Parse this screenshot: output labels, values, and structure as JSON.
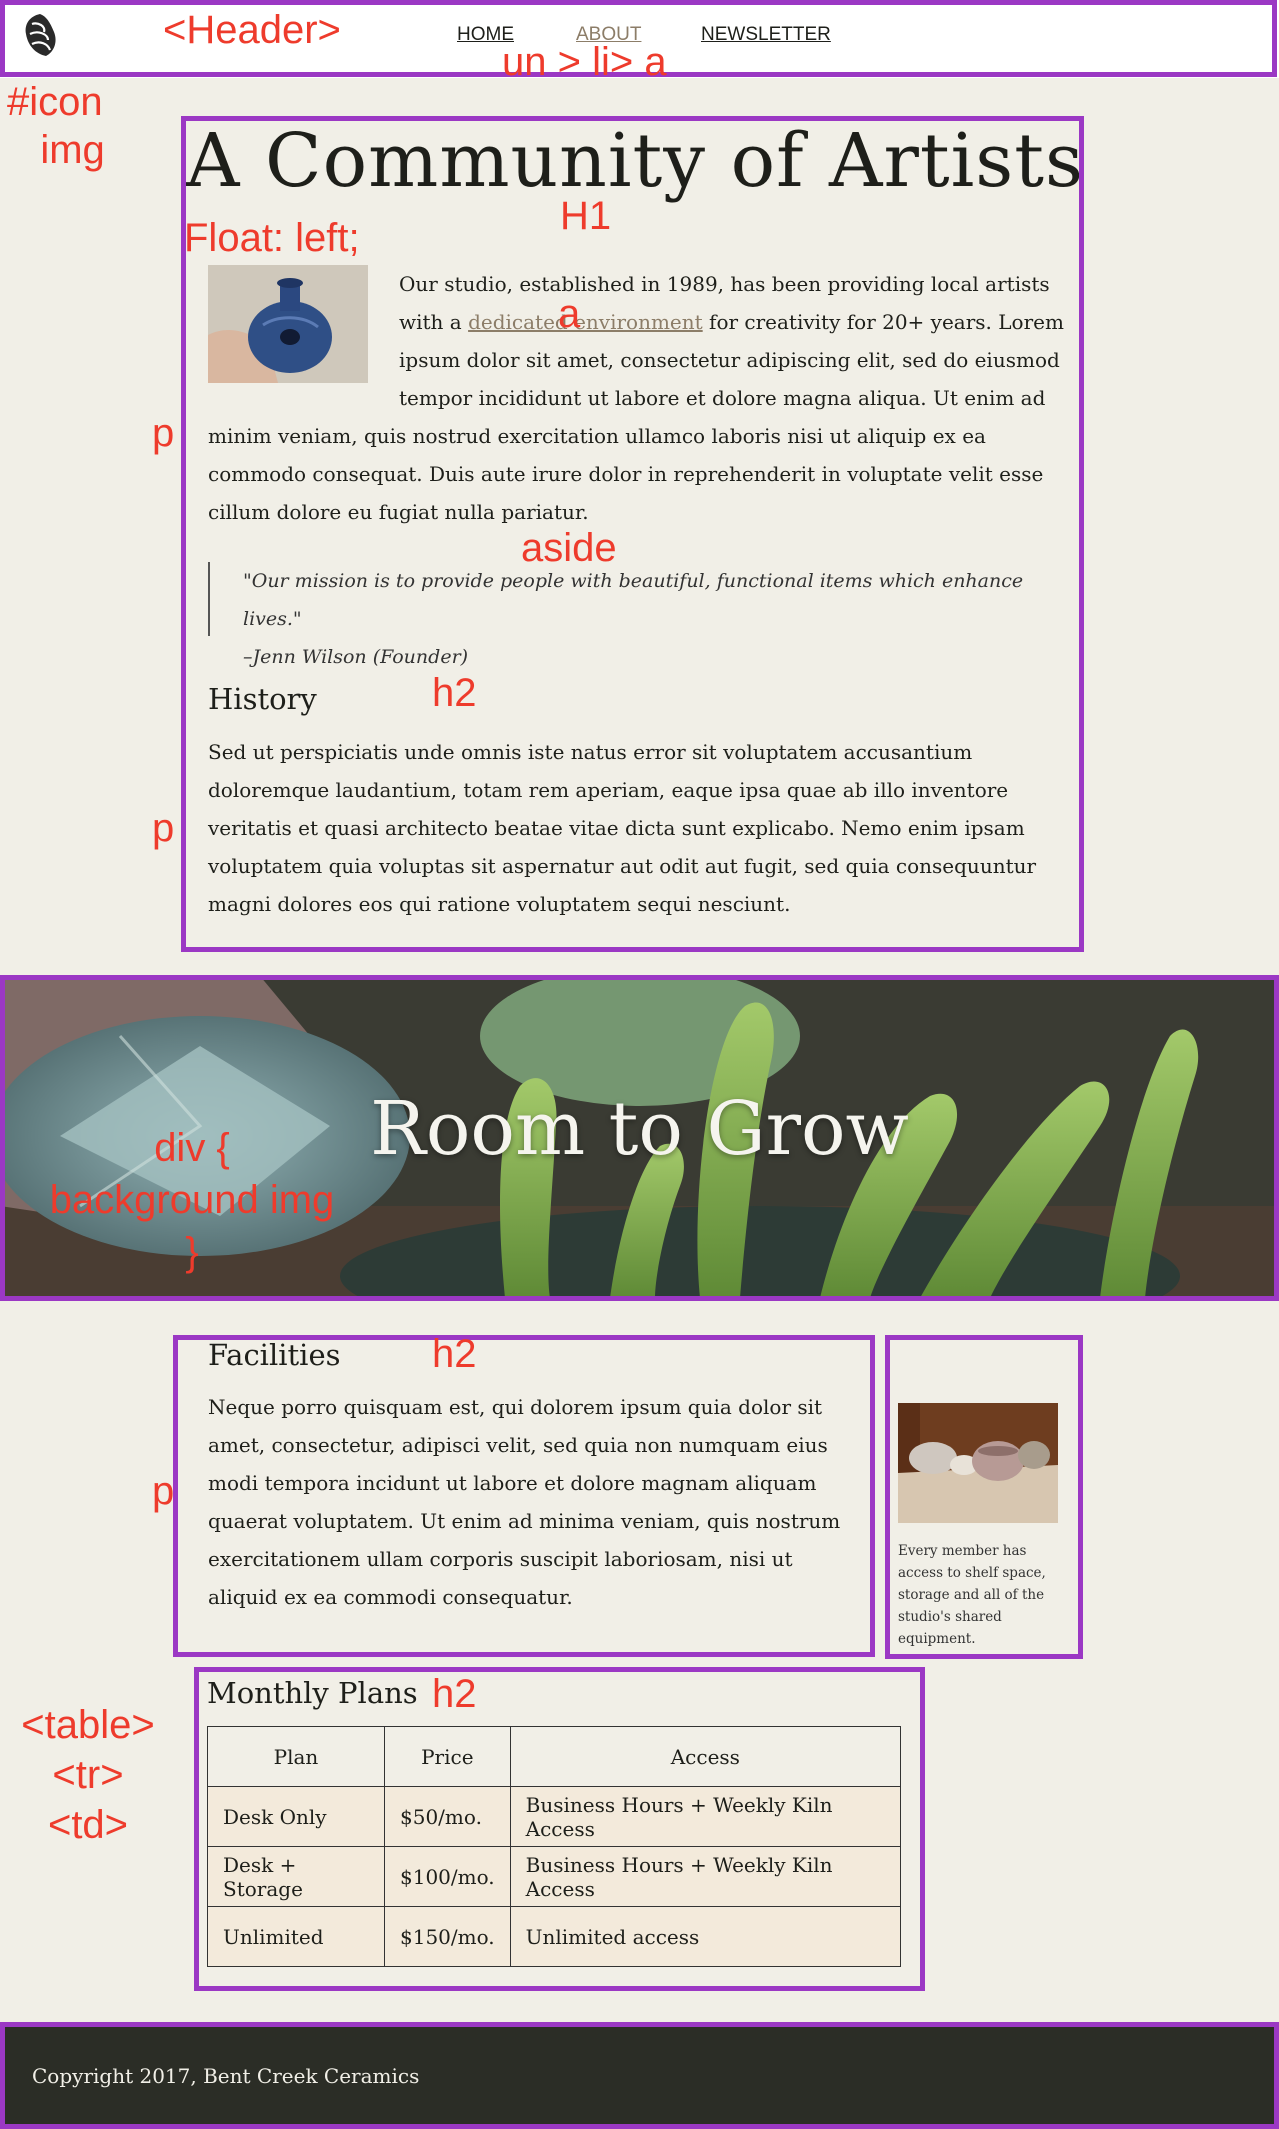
{
  "header": {
    "nav": [
      {
        "label": "HOME"
      },
      {
        "label": "ABOUT"
      },
      {
        "label": "NEWSLETTER"
      }
    ]
  },
  "main": {
    "title": "A Community of Artists",
    "intro_before_link": "Our studio, established in 1989, has been providing local artists with a ",
    "intro_link": "dedicated environment",
    "intro_after_link": " for creativity for 20+ years. Lorem ipsum dolor sit amet, consectetur adipiscing elit, sed do eiusmod tempor incididunt ut labore et dolore magna aliqua. Ut enim ad minim veniam, quis nostrud exercitation ullamco laboris nisi ut aliquip ex ea commodo consequat. Duis aute irure dolor in reprehenderit in voluptate velit esse cillum dolore eu fugiat nulla pariatur.",
    "quote": "\"Our mission is to provide people with beautiful, functional items which enhance lives.\"",
    "quote_author": "–Jenn Wilson (Founder)",
    "history_heading": "History",
    "history_text": "Sed ut perspiciatis unde omnis iste natus error sit voluptatem accusantium doloremque laudantium, totam rem aperiam, eaque ipsa quae ab illo inventore veritatis et quasi architecto beatae vitae dicta sunt explicabo. Nemo enim ipsam voluptatem quia voluptas sit aspernatur aut odit aut fugit, sed quia consequuntur magni dolores eos qui ratione voluptatem sequi nesciunt."
  },
  "hero": {
    "title": "Room to Grow"
  },
  "facilities": {
    "heading": "Facilities",
    "text": "Neque porro quisquam est, qui dolorem ipsum quia dolor sit amet, consectetur, adipisci velit, sed quia non numquam eius modi tempora incidunt ut labore et dolore magnam aliquam quaerat voluptatem. Ut enim ad minima veniam, quis nostrum exercitationem ullam corporis suscipit laboriosam, nisi ut aliquid ex ea commodi consequatur.",
    "caption": "Every member has access to shelf space, storage and all of the studio's shared equipment."
  },
  "plans": {
    "heading": "Monthly Plans",
    "headers": [
      "Plan",
      "Price",
      "Access"
    ],
    "rows": [
      [
        "Desk Only",
        "$50/mo.",
        "Business Hours + Weekly Kiln Access"
      ],
      [
        "Desk + Storage",
        "$100/mo.",
        "Business Hours + Weekly Kiln Access"
      ],
      [
        "Unlimited",
        "$150/mo.",
        "Unlimited access"
      ]
    ]
  },
  "footer": {
    "copyright": "Copyright 2017, Bent Creek Ceramics"
  },
  "annotations": {
    "header": "<Header>",
    "nav": "un > li> a",
    "icon": "#icon\n   img",
    "h1": "H1",
    "float": "Float: left;",
    "a": "a",
    "p": "p",
    "aside": "aside",
    "h2": "h2",
    "bg_div": "div {\nbackground img\n}",
    "table": "<table>\n<tr>\n<td>"
  },
  "colors": {
    "annotation_box": "#9b38c4",
    "annotation_text": "#ee3b2c",
    "link": "#8c7d68",
    "background": "#f1efe7",
    "footer": "#2b2d26"
  }
}
